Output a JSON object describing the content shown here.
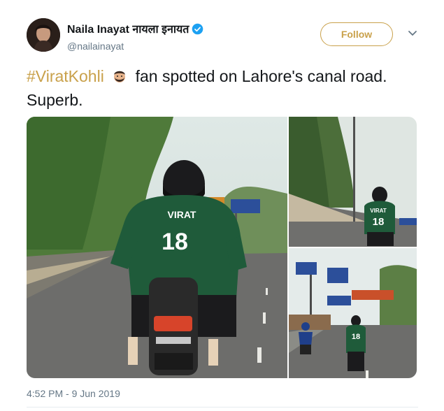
{
  "author": {
    "display_name": "Naila Inayat नायला इनायत",
    "handle": "@nailainayat",
    "verified": true,
    "avatar_icon": "profile-photo"
  },
  "actions": {
    "follow_label": "Follow",
    "more_icon": "chevron-down-icon"
  },
  "tweet": {
    "hashtag": "#ViratKohli",
    "emoji_icon": "man-bearded-face-emoji",
    "text_after_emoji": "fan spotted on Lahore's canal road.  Superb.",
    "timestamp": "4:52 PM - 9 Jun 2019"
  },
  "media": {
    "jersey_name": "VIRAT",
    "jersey_number": "18",
    "jersey_name_small": "VIRAT",
    "jersey_number_small": "18",
    "jersey_number_small_2": "18"
  },
  "colors": {
    "accent": "#c9a14b",
    "text": "#14171a",
    "muted": "#657786",
    "verified": "#1da1f2",
    "jersey_green": "#1f5b3a"
  }
}
